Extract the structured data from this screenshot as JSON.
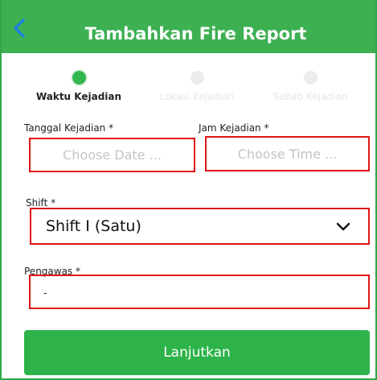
{
  "header": {
    "title": "Tambahkan Fire Report",
    "back_icon": "chevron-left-icon"
  },
  "steps": [
    {
      "label": "Waktu Kejadian",
      "state": "active"
    },
    {
      "label": "Lokasi Kejadian",
      "state": "inactive"
    },
    {
      "label": "Sebab Kejadian",
      "state": "inactive"
    }
  ],
  "form": {
    "date_label": "Tanggal Kejadian *",
    "date_placeholder": "Choose Date ...",
    "time_label": "Jam Kejadian *",
    "time_placeholder": "Choose Time ...",
    "shift_label": "Shift *",
    "shift_value": "Shift I (Satu)",
    "pengawas_label": "Pengawas *",
    "pengawas_value": "-"
  },
  "submit_label": "Lanjutkan",
  "colors": {
    "primary": "#3db052",
    "button": "#2eb34a",
    "highlight": "#e01515"
  }
}
